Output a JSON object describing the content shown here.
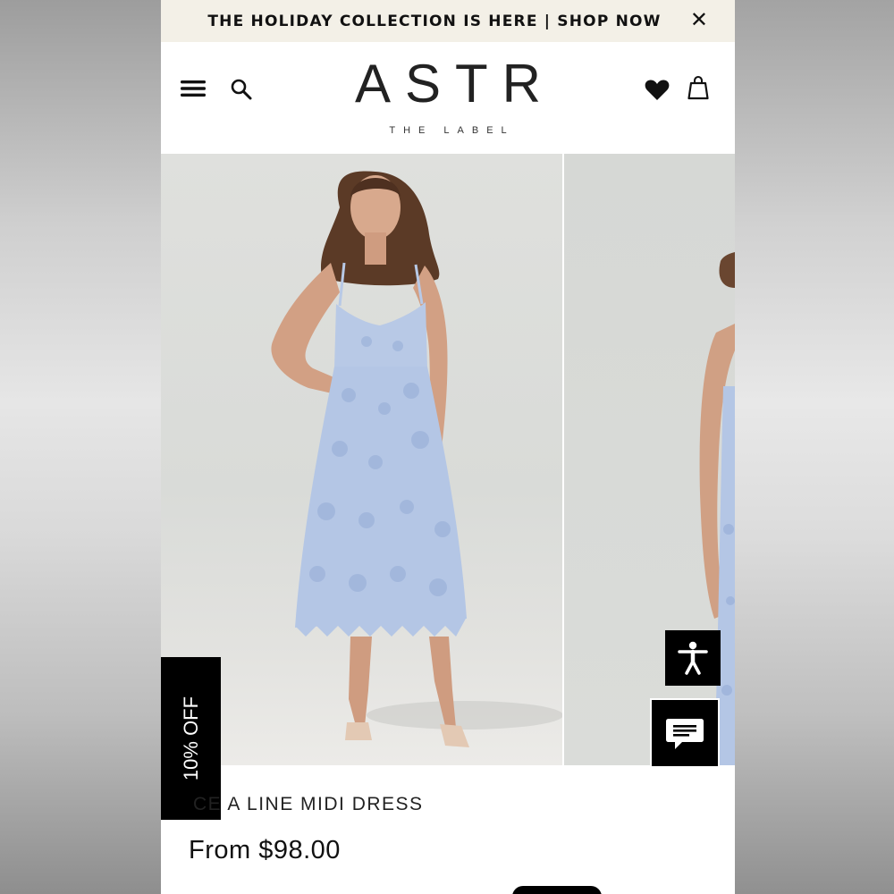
{
  "announcement": {
    "text": "THE HOLIDAY COLLECTION IS HERE | SHOP NOW",
    "close_glyph": "✕"
  },
  "header": {
    "logo": "ASTR",
    "logo_sub": "THE LABEL",
    "icons": [
      "menu-icon",
      "search-icon",
      "heart-icon",
      "bag-icon"
    ]
  },
  "gallery": {
    "images": [
      "main-product-photo",
      "next-product-photo"
    ],
    "dress_color": "#b8c9e6"
  },
  "floating": {
    "promo": "10% OFF",
    "accessibility_icon": "accessibility-icon",
    "chat_icon": "chat-icon"
  },
  "product": {
    "title": "CE A LINE MIDI DRESS",
    "price": "From $98.00"
  },
  "colors": {
    "announcement_bg": "#f3f0e7",
    "text": "#111111",
    "button_bg": "#000000"
  }
}
